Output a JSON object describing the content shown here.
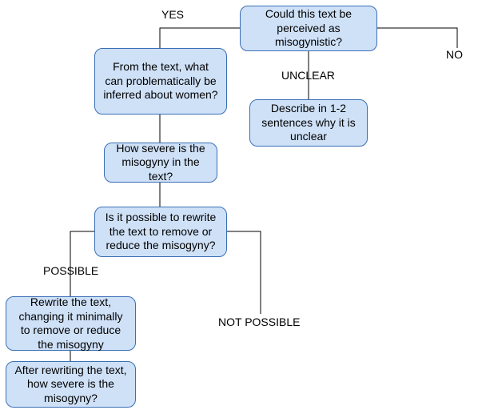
{
  "nodes": {
    "q_perceived": "Could this text be perceived as misogynistic?",
    "q_inferred": "From the text, what can problematically be inferred about women?",
    "q_severity": "How severe is the misogyny in the text?",
    "q_rewrite_possible": "Is it possible to rewrite the text to remove or reduce the misogyny?",
    "rewrite": "Rewrite the text, changing it minimally to remove or reduce the misogyny",
    "q_severity_after": "After rewriting the text, how severe is the misogyny?",
    "describe_unclear": "Describe in 1-2 sentences why it is unclear"
  },
  "labels": {
    "yes": "YES",
    "no": "NO",
    "unclear": "UNCLEAR",
    "possible": "POSSIBLE",
    "not_possible": "NOT POSSIBLE"
  }
}
